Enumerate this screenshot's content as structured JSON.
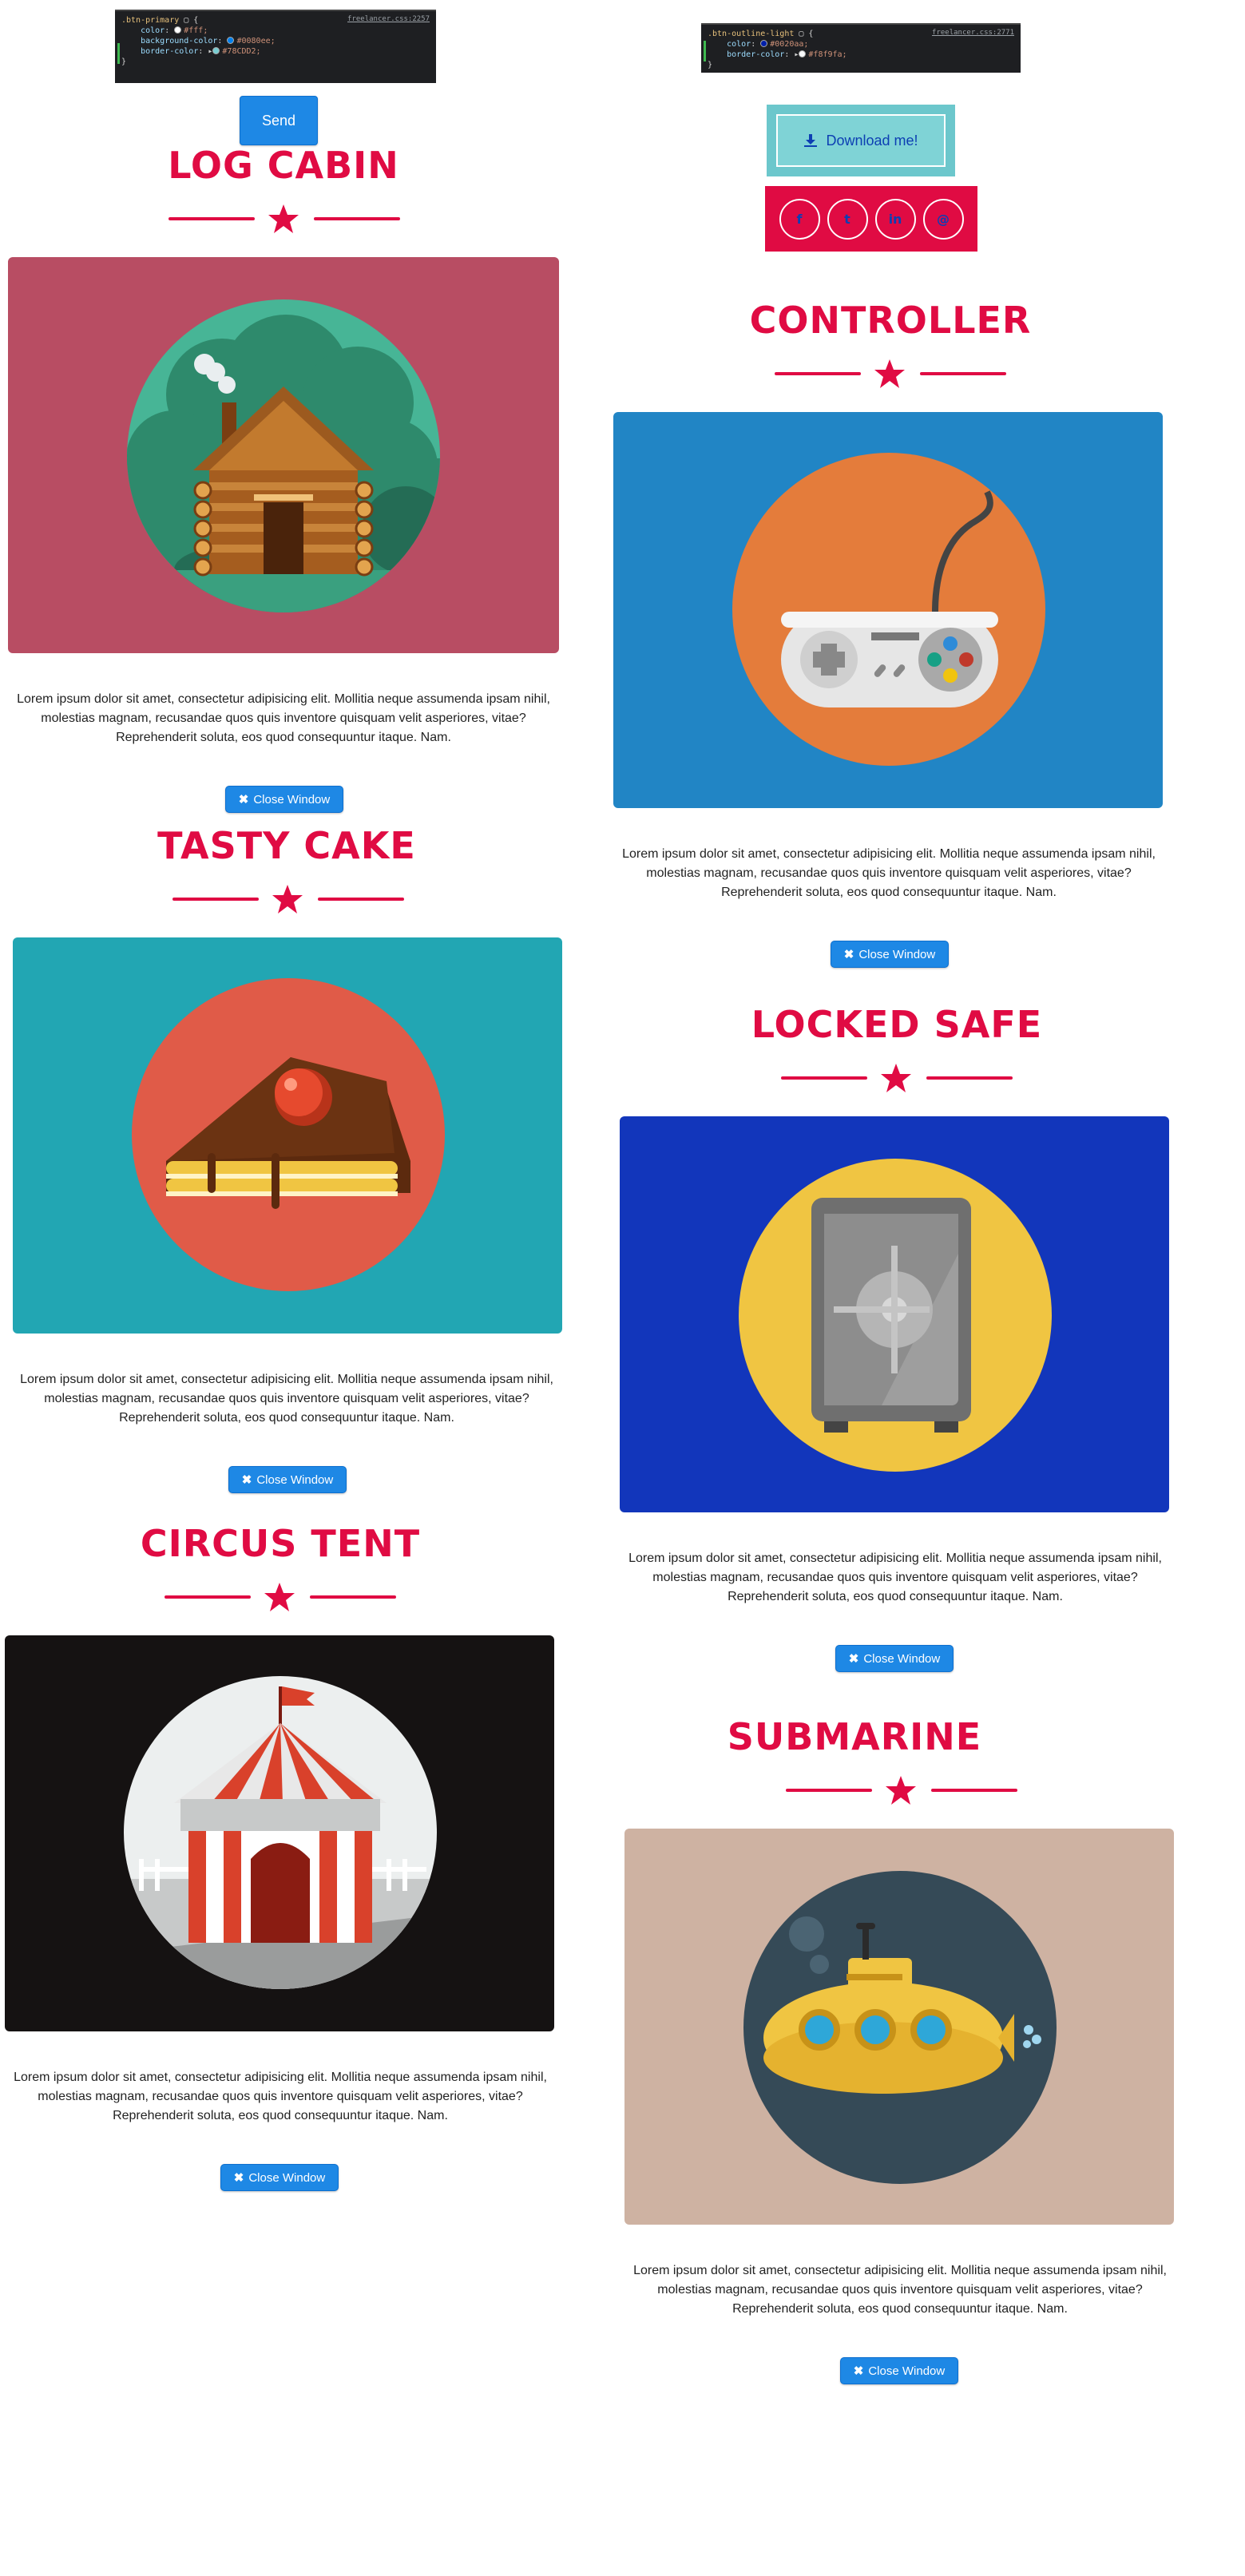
{
  "code_snippets": {
    "primary": {
      "source": "freelancer.css:2257",
      "selector": ".btn-primary",
      "lines": [
        {
          "prop": "color",
          "swatch": "#ffffff",
          "value": "#fff;"
        },
        {
          "prop": "background-color",
          "swatch": "#0080ee",
          "value": "#0080ee;"
        },
        {
          "prop": "border-color",
          "swatch": "#78CDD2",
          "value": "#78CDD2;"
        }
      ]
    },
    "outline_light": {
      "source": "freelancer.css:2771",
      "selector": ".btn-outline-light",
      "lines": [
        {
          "prop": "color",
          "swatch": "#0020aa",
          "value": "#0020aa;"
        },
        {
          "prop": "border-color",
          "swatch": "#f8f9fa",
          "value": "#f8f9fa;"
        }
      ]
    }
  },
  "send_label": "Send",
  "download_label": "Download me!",
  "social": [
    "f",
    "t",
    "in",
    "@"
  ],
  "projects": [
    {
      "title": "LOG CABIN",
      "bg": "#b84d63",
      "circle": "#47b596"
    },
    {
      "title": "CONTROLLER",
      "bg": "#2185c5",
      "circle": "#e47c3b"
    },
    {
      "title": "TASTY CAKE",
      "bg": "#22a6b3",
      "circle": "#e05b48"
    },
    {
      "title": "LOCKED SAFE",
      "bg": "#1236bb",
      "circle": "#f0c542"
    },
    {
      "title": "CIRCUS TENT",
      "bg": "#151212",
      "circle": "#ecefef"
    },
    {
      "title": "SUBMARINE",
      "bg": "#ceb2a2",
      "circle": "#354a57"
    }
  ],
  "paragraph": "Lorem ipsum dolor sit amet, consectetur adipisicing elit. Mollitia neque assumenda ipsam nihil, molestias magnam, recusandae quos quis inventore quisquam velit asperiores, vitae? Reprehenderit soluta, eos quod consequuntur itaque. Nam.",
  "close_label": "Close Window",
  "accent": "#e00b43"
}
